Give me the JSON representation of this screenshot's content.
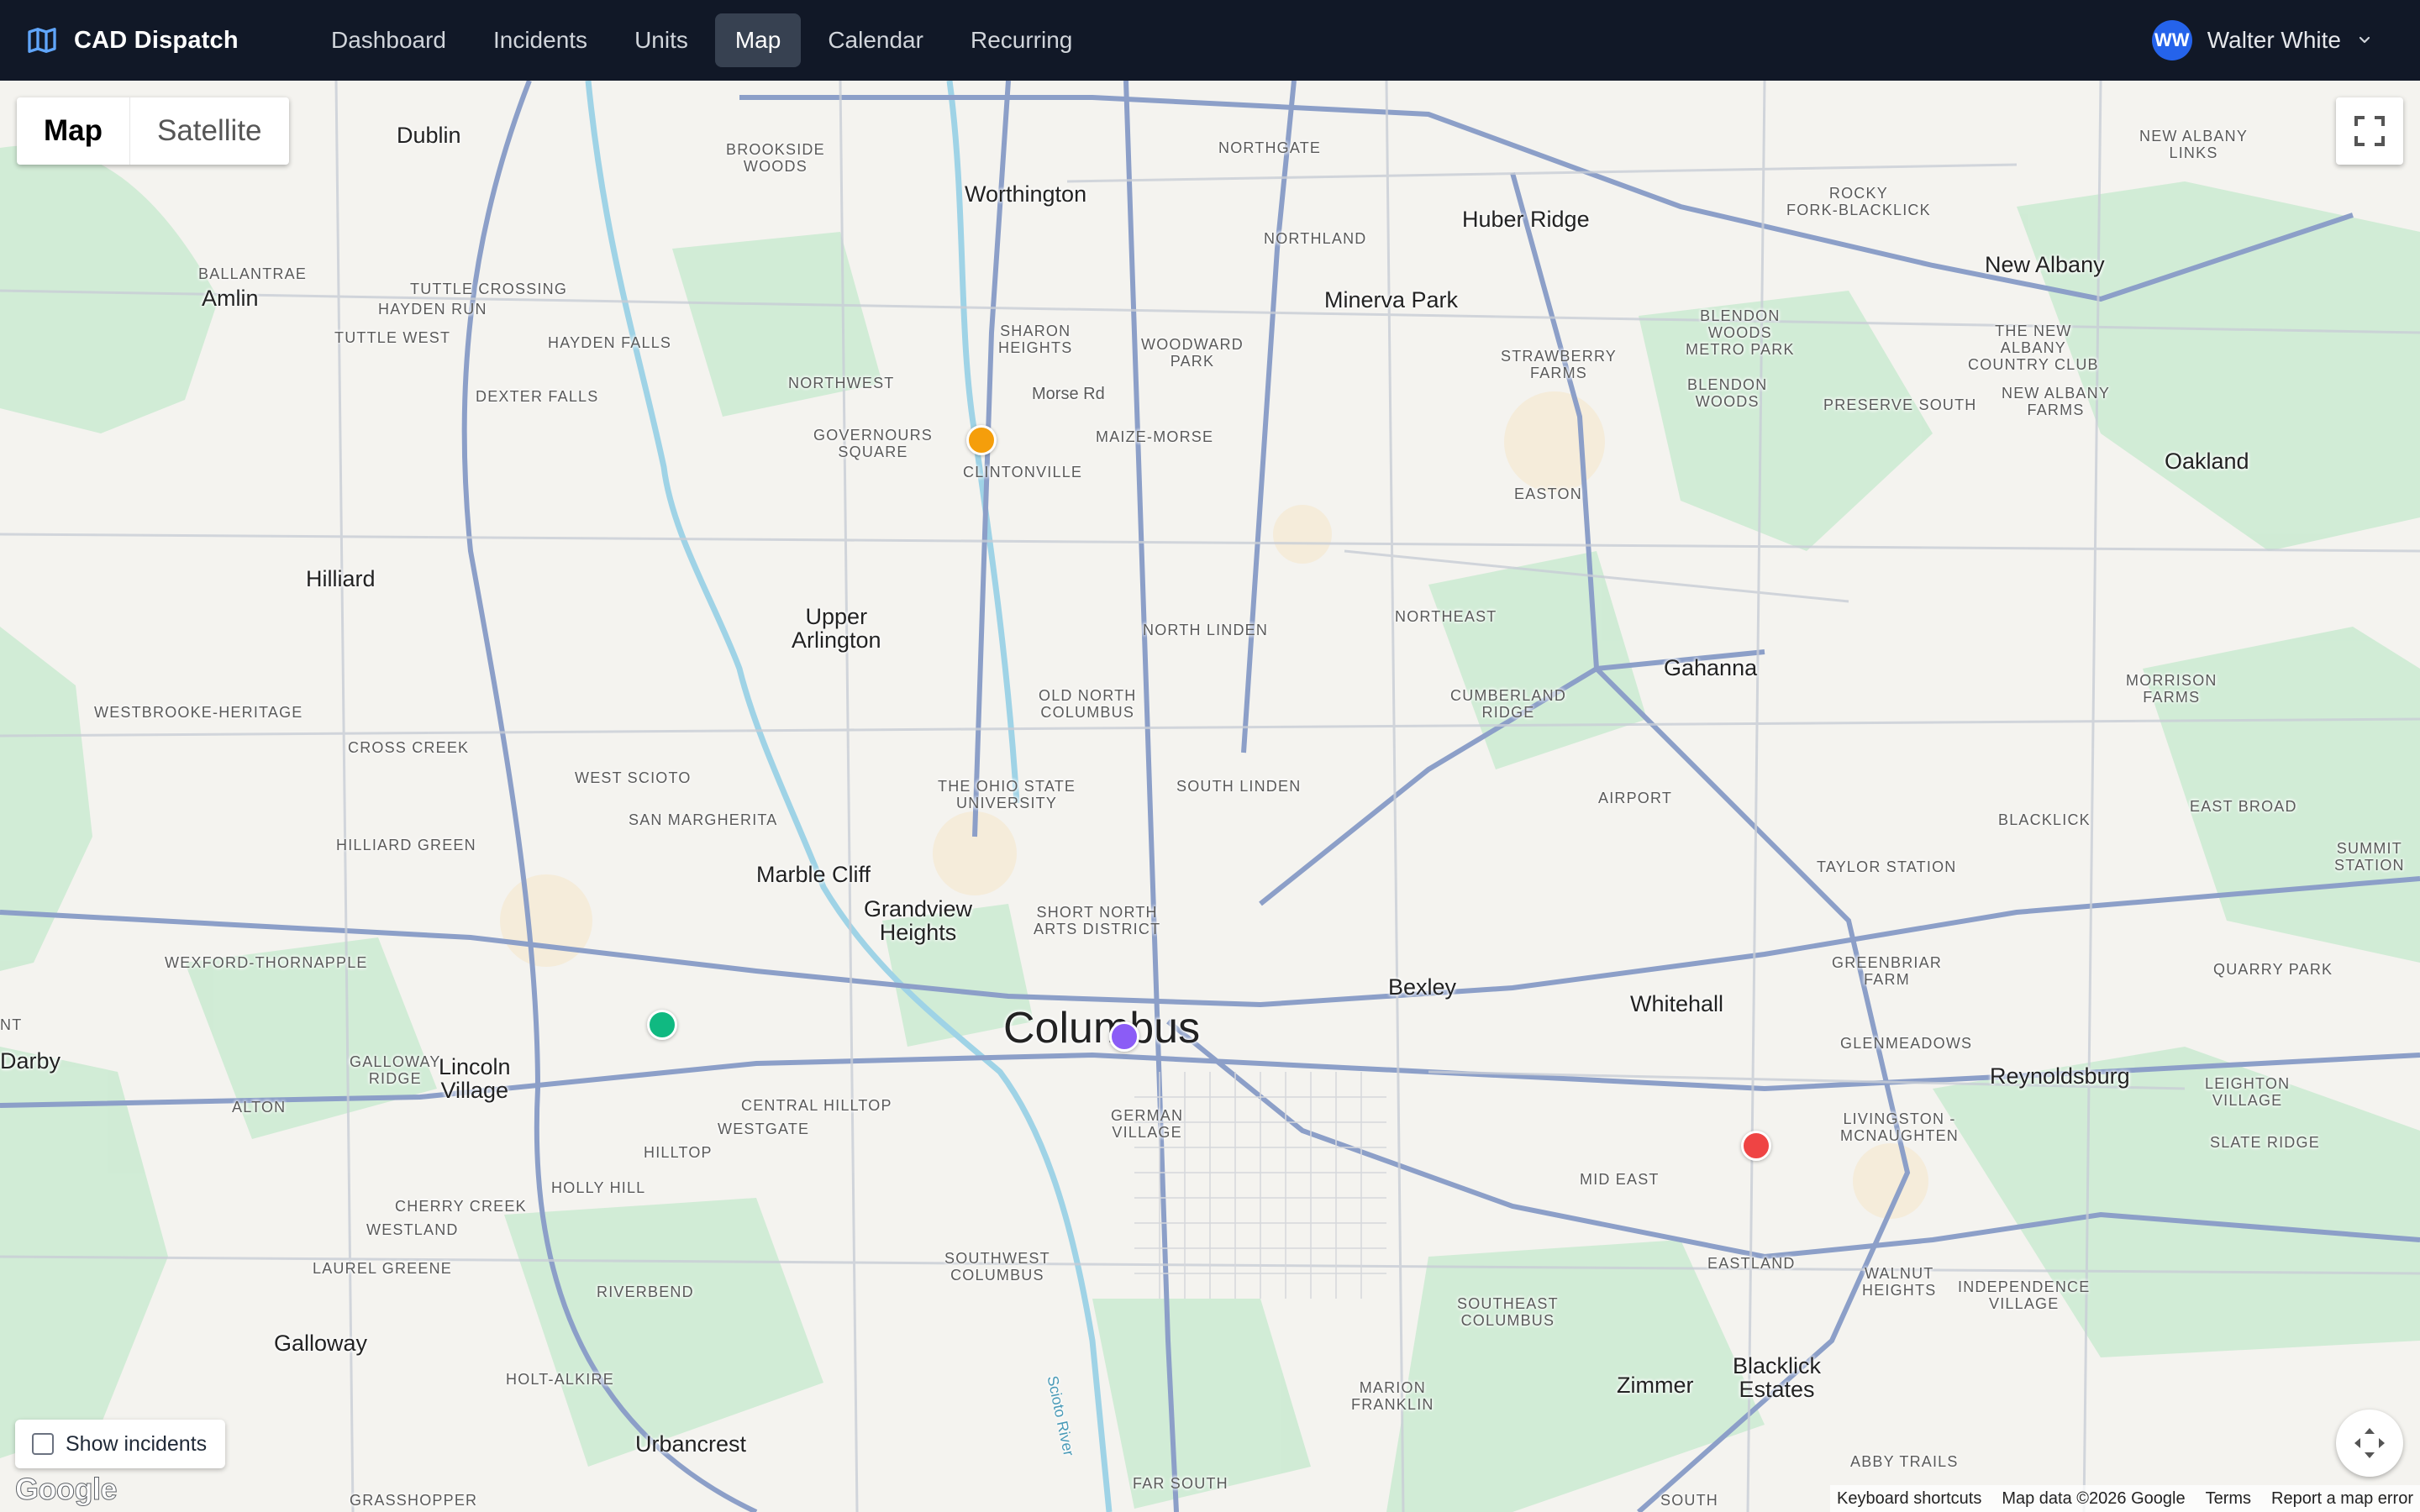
{
  "app": {
    "name": "CAD Dispatch",
    "icon": "map-icon"
  },
  "nav": {
    "items": [
      {
        "label": "Dashboard"
      },
      {
        "label": "Incidents"
      },
      {
        "label": "Units"
      },
      {
        "label": "Map",
        "active": true
      },
      {
        "label": "Calendar"
      },
      {
        "label": "Recurring"
      }
    ]
  },
  "user": {
    "initials": "WW",
    "name": "Walter White",
    "avatar_color": "#2563eb"
  },
  "map": {
    "type_control": {
      "map_label": "Map",
      "satellite_label": "Satellite",
      "selected": "Map"
    },
    "show_incidents": {
      "label": "Show incidents",
      "checked": false
    },
    "google_logo": "Google",
    "attribution": {
      "shortcuts": "Keyboard shortcuts",
      "data": "Map data ©2026 Google",
      "terms": "Terms",
      "report": "Report a map error"
    },
    "places": {
      "dublin": "Dublin",
      "worthington": "Worthington",
      "huber_ridge": "Huber Ridge",
      "minerva_park": "Minerva Park",
      "new_albany": "New Albany",
      "amlin": "Amlin",
      "hilliard": "Hilliard",
      "upper_arlington": "Upper\nArlington",
      "gahanna": "Gahanna",
      "oakland": "Oakland",
      "marble_cliff": "Marble Cliff",
      "grandview_heights": "Grandview\nHeights",
      "columbus": "Columbus",
      "bexley": "Bexley",
      "whitehall": "Whitehall",
      "reynoldsburg": "Reynoldsburg",
      "lincoln_village": "Lincoln\nVillage",
      "darby": "Darby",
      "galloway": "Galloway",
      "urbancrest": "Urbancrest",
      "zimmer": "Zimmer",
      "blacklick_estates": "Blacklick\nEstates",
      "brookside_woods": "BROOKSIDE\nWOODS",
      "northgate": "NORTHGATE",
      "rocky_fork": "ROCKY\nFORK-BLACKLICK",
      "new_albany_links": "NEW ALBANY\nLINKS",
      "ballantrae": "BALLANTRAE",
      "tuttle_crossing": "TUTTLE CROSSING",
      "hayden_run": "HAYDEN RUN",
      "tuttle_west": "TUTTLE WEST",
      "hayden_falls": "HAYDEN FALLS",
      "dexter_falls": "DEXTER FALLS",
      "northwest": "NORTHWEST",
      "governours_square": "GOVERNOURS\nSQUARE",
      "sharon_heights": "SHARON\nHEIGHTS",
      "woodward_park": "WOODWARD\nPARK",
      "northland": "NORTHLAND",
      "strawberry_farms": "STRAWBERRY\nFARMS",
      "blendon_woods_metro": "BLENDON\nWOODS\nMETRO PARK",
      "blendon_woods": "BLENDON\nWOODS",
      "preserve_south": "PRESERVE SOUTH",
      "new_albany_cc": "THE NEW\nALBANY\nCOUNTRY CLUB",
      "new_albany_farms": "NEW ALBANY\nFARMS",
      "maize_morse": "MAIZE-MORSE",
      "clintonville": "CLINTONVILLE",
      "morse_rd": "Morse Rd",
      "easton": "EASTON",
      "north_linden": "NORTH LINDEN",
      "northeast": "NORTHEAST",
      "westbrooke": "WESTBROOKE-HERITAGE",
      "cross_creek": "CROSS CREEK",
      "old_north_columbus": "OLD NORTH\nCOLUMBUS",
      "cumberland_ridge": "CUMBERLAND\nRIDGE",
      "morrison_farms": "MORRISON\nFARMS",
      "west_scioto": "WEST SCIOTO",
      "ohio_state": "THE OHIO STATE\nUNIVERSITY",
      "south_linden": "SOUTH LINDEN",
      "airport": "AIRPORT",
      "blacklick": "BLACKLICK",
      "east_broad": "EAST BROAD",
      "san_margherita": "SAN MARGHERITA",
      "hilliard_green": "HILLIARD GREEN",
      "taylor_station": "TAYLOR STATION",
      "summit_station": "SUMMIT\nSTATION",
      "short_north": "SHORT NORTH\nARTS DISTRICT",
      "greenbriar_farm": "GREENBRIAR\nFARM",
      "wexford_thornapple": "WEXFORD-THORNAPPLE",
      "quarry_park": "QUARRY PARK",
      "glenmeadows": "GLENMEADOWS",
      "galloway_ridge": "GALLOWAY\nRIDGE",
      "leighton_village": "LEIGHTON\nVILLAGE",
      "alton": "ALTON",
      "central_hilltop": "CENTRAL HILLTOP",
      "german_village": "GERMAN\nVILLAGE",
      "livingston": "LIVINGSTON -\nMCNAUGHTEN",
      "westgate": "WESTGATE",
      "slate_ridge": "SLATE RIDGE",
      "hilltop": "HILLTOP",
      "mid_east": "MID EAST",
      "holly_hill": "HOLLY HILL",
      "cherry_creek": "CHERRY CREEK",
      "westland": "WESTLAND",
      "laurel_greene": "LAUREL GREENE",
      "southwest_columbus": "SOUTHWEST\nCOLUMBUS",
      "eastland": "EASTLAND",
      "walnut_heights": "WALNUT\nHEIGHTS",
      "independence_village": "INDEPENDENCE\nVILLAGE",
      "riverbend": "RIVERBEND",
      "southeast_columbus": "SOUTHEAST\nCOLUMBUS",
      "holt_alkire": "HOLT-ALKIRE",
      "marion_franklin": "MARION\nFRANKLIN",
      "abby_trails": "ABBY TRAILS",
      "grasshopper": "GRASSHOPPER",
      "far_south": "FAR SOUTH",
      "south": "SOUTH",
      "nt": "NT",
      "scioto_river": "Scioto River"
    },
    "markers": [
      {
        "name": "orange",
        "color": "#f59e0b"
      },
      {
        "name": "purple",
        "color": "#8b5cf6"
      },
      {
        "name": "green",
        "color": "#10b981"
      },
      {
        "name": "red",
        "color": "#ef4444"
      }
    ]
  }
}
